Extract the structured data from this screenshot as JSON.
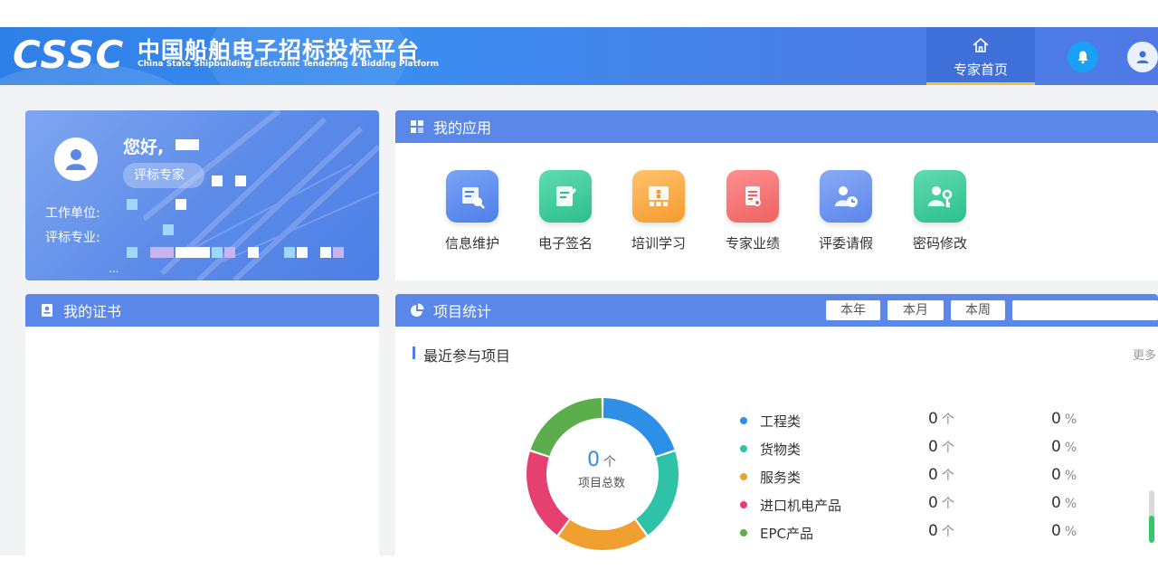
{
  "header": {
    "logo_text": "CSSC",
    "title_cn": "中国船舶电子招标投标平台",
    "title_en": "China State Shipbuilding Electronic Tendering & Bidding Platform",
    "nav_home_label": "专家首页",
    "accent_color": "#f5c13a"
  },
  "profile": {
    "greeting": "您好,",
    "role": "评标专家",
    "work_unit_label": "工作单位:",
    "major_label": "评标专业:",
    "ellipsis": "..."
  },
  "apps_panel": {
    "title": "我的应用",
    "items": [
      {
        "label": "信息维护",
        "icon": "info-maintain-icon",
        "color": "#4f7fe8"
      },
      {
        "label": "电子签名",
        "icon": "e-signature-icon",
        "color": "#2dbf8c"
      },
      {
        "label": "培训学习",
        "icon": "training-icon",
        "color": "#f59a2f"
      },
      {
        "label": "专家业绩",
        "icon": "performance-icon",
        "color": "#ee6161"
      },
      {
        "label": "评委请假",
        "icon": "leave-icon",
        "color": "#5a86ec"
      },
      {
        "label": "密码修改",
        "icon": "password-key-icon",
        "color": "#2dbf8c"
      }
    ]
  },
  "cert_panel": {
    "title": "我的证书"
  },
  "stats_panel": {
    "title": "项目统计",
    "tabs": [
      "本年",
      "本月",
      "本周"
    ],
    "section_title": "最近参与项目",
    "more_label": "更多",
    "total_value": "0",
    "total_unit": "个",
    "total_label": "项目总数"
  },
  "chart_data": {
    "type": "pie",
    "categories": [
      "工程类",
      "货物类",
      "服务类",
      "进口机电产品",
      "EPC产品"
    ],
    "values": [
      0,
      0,
      0,
      0,
      0
    ],
    "percents": [
      0,
      0,
      0,
      0,
      0
    ],
    "count_unit": "个",
    "percent_unit": "%",
    "colors": [
      "#2e8fe6",
      "#2ec3a6",
      "#f0a030",
      "#e5406f",
      "#5cae4c"
    ],
    "legend_position": "right"
  }
}
